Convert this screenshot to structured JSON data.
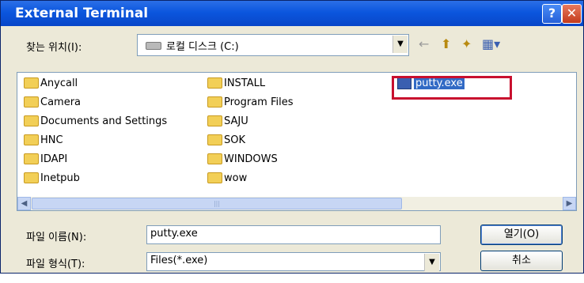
{
  "window": {
    "title": "External Terminal",
    "help_glyph": "?",
    "close_glyph": "✕"
  },
  "lookin": {
    "label": "찾는 위치(I):",
    "value": "로컬 디스크 (C:)",
    "arrow": "▼"
  },
  "nav": {
    "back": "←",
    "up": "⬆",
    "newfolder": "✦",
    "views": "▦▾"
  },
  "files": {
    "col1": [
      "Anycall",
      "Camera",
      "Documents and Settings",
      "HNC",
      "IDAPI",
      "Inetpub"
    ],
    "col2": [
      "INSTALL",
      "Program Files",
      "SAJU",
      "SOK",
      "WINDOWS",
      "wow"
    ],
    "selected": "putty.exe"
  },
  "scroll": {
    "left": "◀",
    "right": "▶",
    "grip": "|||"
  },
  "filename": {
    "label": "파일 이름(N):",
    "value": "putty.exe"
  },
  "filetype": {
    "label": "파일 형식(T):",
    "value": "Files(*.exe)",
    "arrow": "▼"
  },
  "buttons": {
    "open": "열기(O)",
    "cancel": "취소"
  },
  "colors": {
    "title_bar": "#0b56de",
    "dialog_bg": "#ece9d8",
    "selection": "#316ac5",
    "highlight_box": "#c8102e"
  }
}
